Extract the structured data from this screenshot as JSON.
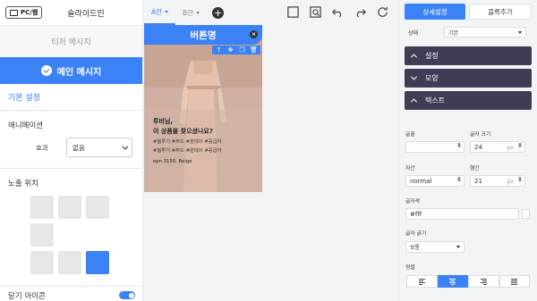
{
  "left_panel": {
    "device_toggle_label": "PC/웹",
    "topbar_title": "슬라이드인",
    "teaser_tab_label": "티저 메시지",
    "main_tab_label": "메인 메시지",
    "basic_settings_label": "기본 설정",
    "animation_label": "애니메이션",
    "effect_label": "효과",
    "effect_value": "없음",
    "exposure_position_label": "노출 위치",
    "position_grid": {
      "rows": 3,
      "cols": 3,
      "hidden_cells": [
        "middle-center",
        "middle-right"
      ],
      "selected_cell": "bottom-right"
    },
    "close_icon_label": "닫기 아이콘",
    "close_icon_enabled": true
  },
  "top_bar": {
    "tab_a": "A안",
    "tab_b": "B안",
    "active_tab": "A안",
    "add_label": "+"
  },
  "preview": {
    "banner_text": "버튼명",
    "banner_close": "×",
    "toolbar_icons": [
      "arrow-up-icon",
      "move-icon",
      "copy-icon",
      "trash-icon"
    ],
    "overlay_line1": "루비님,",
    "overlay_line2": "이 상품을 찾으셨나요?",
    "overlay_line3": "#봄루기 #무드 #원데이 #중급자",
    "overlay_line4": "#봄루기 #무드 #원데이 #중급자",
    "overlay_line5": "opn 3150, Beige",
    "colors": {
      "accent": "#3b82f6",
      "photo_bg": "#c9a999"
    }
  },
  "right_panel": {
    "tab_detail": "상세설정",
    "tab_block_add": "블록추가",
    "status_label": "상태",
    "status_value": "기본",
    "accordion_settings": "설정",
    "accordion_shape": "모양",
    "accordion_text": "텍스트",
    "font_label": "글꼴",
    "font_value": "",
    "font_size_label": "글자 크기",
    "font_size_value": "24",
    "font_size_unit": "px",
    "letter_spacing_label": "자간",
    "letter_spacing_value": "normal",
    "line_height_label": "행간",
    "line_height_value": "21",
    "line_height_unit": "px",
    "text_color_label": "글자색",
    "text_color_value": "#fff",
    "font_weight_label": "글자 굵기",
    "font_weight_value": "보통",
    "align_label": "정렬",
    "align_options": [
      "left",
      "center",
      "right",
      "justify"
    ],
    "align_selected": "center",
    "accordion_color": "#3d3d55"
  }
}
